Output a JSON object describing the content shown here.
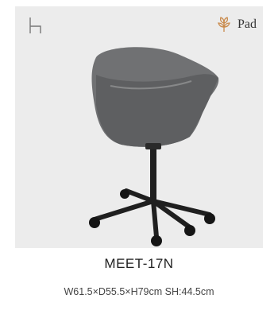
{
  "product": {
    "model": "MEET-17N",
    "dimensions": "W61.5×D55.5×H79cm  SH:44.5cm"
  },
  "badges": {
    "pad_label": "Pad",
    "pad_icon": "wheat-leaf-icon",
    "chair_icon": "chair-outline-icon"
  },
  "colors": {
    "panel_bg": "#ececec",
    "chair_shell": "#6f7072",
    "chair_base": "#1f1f1f",
    "pad_icon": "#c98a4b"
  }
}
